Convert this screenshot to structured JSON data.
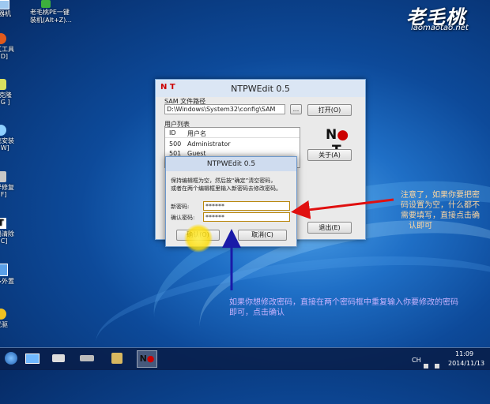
{
  "watermark": {
    "logo": "老毛桃",
    "url": "laomaotao.net"
  },
  "desktop": {
    "top_items": [
      {
        "label1": "器机",
        "label2": ""
      },
      {
        "label1": "老毛桃PE一键",
        "label2": "装机(Alt+Z)..."
      }
    ],
    "left_icons": [
      {
        "label1": "区工具",
        "label2": "+D]"
      },
      {
        "label1": "T克隆",
        "label2": "+G ]"
      },
      {
        "label1": "统安装",
        "label2": "+W]"
      },
      {
        "label1": "导修复",
        "label2": "+F]"
      },
      {
        "label1": "码清除",
        "label2": "+C]"
      },
      {
        "label1": "多外置",
        "label2": ""
      },
      {
        "label1": "光驱",
        "label2": ""
      }
    ]
  },
  "main_window": {
    "title": "NTPWEdit 0.5",
    "icon_label": "N T",
    "sam_label": "SAM 文件路径",
    "sam_path": "D:\\Windows\\System32\\config\\SAM",
    "browse_label": "...",
    "open_label": "打开(O)",
    "user_list_label": "用户列表",
    "columns": [
      "ID",
      "用户名"
    ],
    "users": [
      {
        "id": "500",
        "name": "Administrator"
      },
      {
        "id": "501",
        "name": "Guest"
      }
    ],
    "about_label": "关于(A)",
    "exit_label": "退出(E)"
  },
  "dialog": {
    "title": "NTPWEdit 0.5",
    "info_line1": "保持编辑框为空，然后按“确定”清空密码，",
    "info_line2": "或者在两个编辑框里输入新密码去修改密码。",
    "new_pw_label": "新密码:",
    "new_pw_value": "******",
    "confirm_pw_label": "确认密码:",
    "confirm_pw_value": "******",
    "ok_label": "确认(O)",
    "cancel_label": "取消(C)"
  },
  "annotations": {
    "right_note": [
      "注意了，如果你要把密",
      "码设置为空，什么都不",
      "需要填写，直接点击确",
      "认即可"
    ],
    "bottom_note": [
      "如果你想修改密码，直接在两个密码框中重复输入你要修改的密码",
      "即可，点击确认"
    ]
  },
  "taskbar": {
    "tray_ime": "CH",
    "time": "11:09",
    "date": "2014/11/13"
  },
  "colors": {
    "arrow_red": "#e01010",
    "arrow_blue": "#1a1aa8"
  }
}
